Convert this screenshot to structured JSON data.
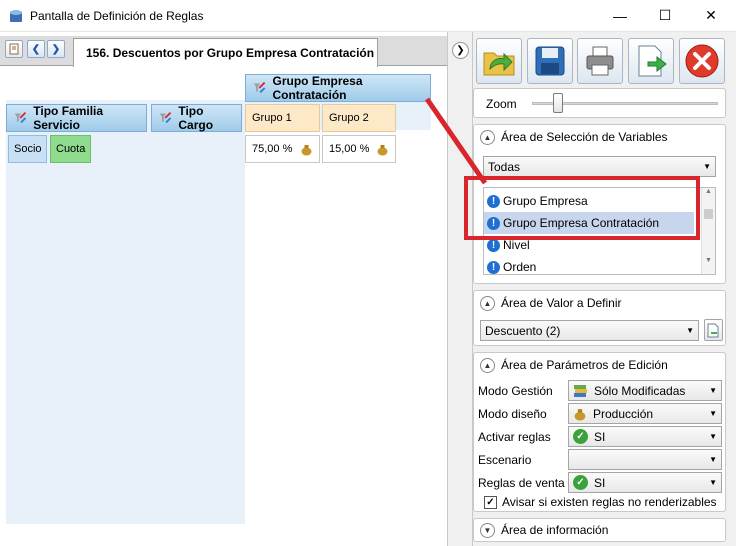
{
  "window": {
    "title": "Pantalla de Definición de Reglas",
    "minimize": "—",
    "maximize": "☐",
    "close": "✕"
  },
  "tab": {
    "label": "156. Descuentos por Grupo Empresa Contratación"
  },
  "grid": {
    "column_header": "Grupo Empresa Contratación",
    "row_headers": [
      "Tipo Familia Servicio",
      "Tipo Cargo"
    ],
    "column_groups": [
      "Grupo 1",
      "Grupo 2"
    ],
    "row_values": [
      "Socio",
      "Cuota"
    ],
    "cell_values": [
      "75,00 %",
      "15,00 %"
    ]
  },
  "toolbar": {
    "icons": [
      "open-folder-icon",
      "save-icon",
      "print-icon",
      "export-icon",
      "close-icon"
    ]
  },
  "zoom": {
    "label": "Zoom",
    "level": 0.12
  },
  "variables": {
    "title": "Área de Selección de Variables",
    "filter": "Todas",
    "items": [
      "Grupo Empresa",
      "Grupo Empresa Contratación",
      "Nivel",
      "Orden"
    ],
    "selected_index": 1
  },
  "value_area": {
    "title": "Área de Valor a Definir",
    "value": "Descuento (2)"
  },
  "params": {
    "title": "Área de Parámetros de Edición",
    "rows": [
      {
        "label": "Modo Gestión",
        "value": "Sólo Modificadas"
      },
      {
        "label": "Modo diseño",
        "value": "Producción"
      },
      {
        "label": "Activar reglas",
        "value": "SI"
      },
      {
        "label": "Escenario",
        "value": ""
      },
      {
        "label": "Reglas de venta",
        "value": "SI"
      }
    ],
    "checkbox_label": "Avisar si existen reglas no renderizables",
    "checkbox_checked": true
  },
  "info": {
    "title": "Área de información"
  },
  "colors": {
    "highlight": "#d9252c",
    "selected_row": "#c7d6ec"
  }
}
